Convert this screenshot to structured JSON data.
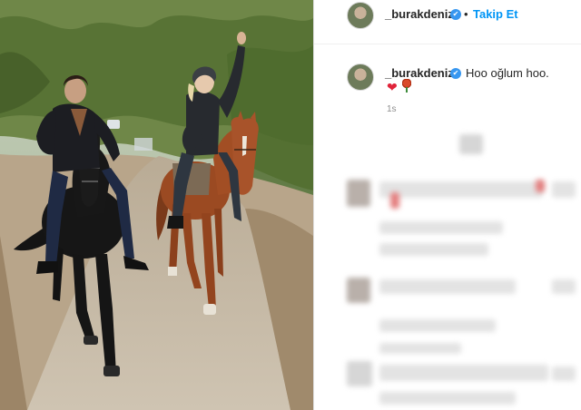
{
  "post": {
    "username": "_burakdeniz",
    "verified_mark": "✔",
    "follow_label": "Takip Et",
    "separator": "•",
    "caption": "Hoo oğlum hoo.",
    "emoji_heart": "❤",
    "time_ago": "1s"
  },
  "icons": {
    "verified": "verified-badge-icon",
    "heart": "heart-emoji",
    "rose": "rose-emoji"
  },
  "colors": {
    "follow": "#0095f6",
    "verified": "#3897f0",
    "heart": "#e0243a"
  }
}
